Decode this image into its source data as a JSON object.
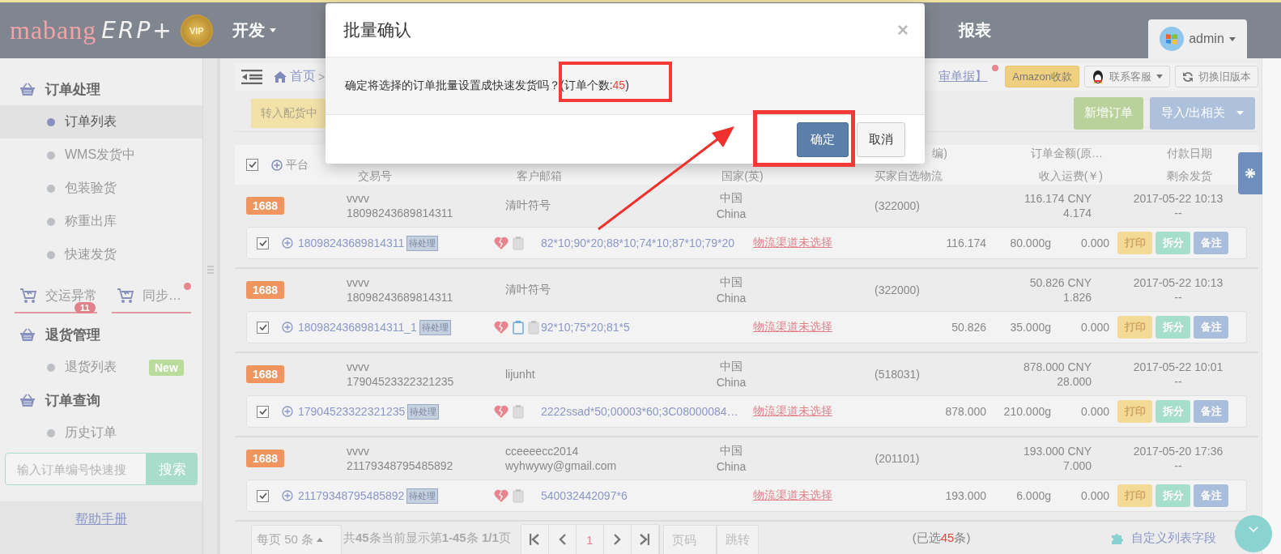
{
  "header": {
    "logo": "mabang",
    "logo_suffix": "ERP+",
    "badge": "VIP",
    "nav": [
      {
        "label": "开发",
        "dropdown": true
      },
      {
        "label": "报表",
        "dropdown": false
      }
    ],
    "user": "admin"
  },
  "sidebar": {
    "blocks": [
      {
        "kind": "section",
        "title": "订单处理",
        "items": [
          {
            "label": "订单列表",
            "selected": true
          },
          {
            "label": "WMS发货中",
            "selected": false
          },
          {
            "label": "包装验货",
            "selected": false
          },
          {
            "label": "称重出库",
            "selected": false
          },
          {
            "label": "快速发货",
            "selected": false
          }
        ]
      },
      {
        "kind": "shortcuts",
        "items": [
          {
            "label": "交运异常",
            "badge": "11",
            "alert": false
          },
          {
            "label": "同步…",
            "alert": true
          }
        ]
      },
      {
        "kind": "section",
        "title": "退货管理",
        "items": [
          {
            "label": "退货列表",
            "selected": false,
            "badge": "New"
          }
        ]
      },
      {
        "kind": "section",
        "title": "订单查询",
        "items": [
          {
            "label": "历史订单",
            "selected": false
          }
        ]
      }
    ],
    "search": {
      "placeholder": "输入订单编号快速搜",
      "button": "搜索"
    },
    "help": "帮助手册"
  },
  "breadcrumb": {
    "home": "首页",
    "separator": ">",
    "link": "审单据】",
    "link_alert": true
  },
  "top_buttons": [
    {
      "label": "Amazon收款",
      "kind": "plain"
    },
    {
      "label": "联系客服",
      "kind": "qq"
    },
    {
      "label": "切换旧版本",
      "kind": "refresh"
    }
  ],
  "toolbar": {
    "left": "转入配货中",
    "new_order": "新增订单",
    "import_export": "导入/出相关"
  },
  "table": {
    "select_all": true,
    "header_top": [
      "平台",
      "编)",
      "订单金额(原…",
      "付款日期"
    ],
    "header_bottom": [
      "交易号",
      "客户邮箱",
      "国家(英)",
      "买家自选物流",
      "收入运费(￥)",
      "剩余发货"
    ],
    "orders": [
      {
        "platform": "1688",
        "shop": "vvvv",
        "trade_no": "18098243689814311",
        "customer": [
          "清叶符号"
        ],
        "country_cn": "中国",
        "country_en": "China",
        "postcode": "(322000)",
        "amount": "116.174 CNY",
        "shipping": "4.174",
        "date": "2017-05-22 10:13",
        "remain": "--",
        "checked": true,
        "order_no": "18098243689814311",
        "status": "待处理",
        "memo": false,
        "sku": "82*10;90*20;88*10;74*10;87*10;79*20",
        "logistics": "物流渠道未选择",
        "price": "116.174",
        "weight": "80.000g",
        "fee": "0.000",
        "actions": [
          "打印",
          "拆分",
          "备注"
        ]
      },
      {
        "platform": "1688",
        "shop": "vvvv",
        "trade_no": "18098243689814311",
        "customer": [
          "清叶符号"
        ],
        "country_cn": "中国",
        "country_en": "China",
        "postcode": "(322000)",
        "amount": "50.826 CNY",
        "shipping": "1.826",
        "date": "2017-05-22 10:13",
        "remain": "--",
        "checked": true,
        "order_no": "18098243689814311_1",
        "status": "待处理",
        "memo": true,
        "sku": "92*10;75*20;81*5",
        "logistics": "物流渠道未选择",
        "price": "50.826",
        "weight": "35.000g",
        "fee": "0.000",
        "actions": [
          "打印",
          "拆分",
          "备注"
        ]
      },
      {
        "platform": "1688",
        "shop": "vvvv",
        "trade_no": "17904523322321235",
        "customer": [
          "lijunht"
        ],
        "country_cn": "中国",
        "country_en": "China",
        "postcode": "(518031)",
        "amount": "878.000 CNY",
        "shipping": "28.000",
        "date": "2017-05-22 10:01",
        "remain": "--",
        "checked": true,
        "order_no": "17904523322321235",
        "status": "待处理",
        "memo": false,
        "sku": "2222ssad*50;00003*60;3C08000084…",
        "logistics": "物流渠道未选择",
        "price": "878.000",
        "weight": "210.000g",
        "fee": "0.000",
        "actions": [
          "打印",
          "拆分",
          "备注"
        ]
      },
      {
        "platform": "1688",
        "shop": "vvvv",
        "trade_no": "21179348795485892",
        "customer": [
          "cceeeecc2014",
          "wyhwywy@gmail.com"
        ],
        "country_cn": "中国",
        "country_en": "China",
        "postcode": "(201101)",
        "amount": "193.000 CNY",
        "shipping": "7.000",
        "date": "2017-05-20 17:36",
        "remain": "--",
        "checked": true,
        "order_no": "21179348795485892",
        "status": "待处理",
        "memo": false,
        "sku": "540032442097*6",
        "logistics": "物流渠道未选择",
        "price": "193.000",
        "weight": "6.000g",
        "fee": "0.000",
        "actions": [
          "打印",
          "拆分",
          "备注"
        ]
      }
    ]
  },
  "pagination": {
    "per_page": "每页 50 条",
    "summary": "共**45**条当前显示第**1-45**条 **1/1**页",
    "current_page": "1",
    "page_placeholder": "页码",
    "go": "跳转",
    "selected_before": "(已选",
    "selected_count": "45",
    "selected_after": "条)",
    "custom_fields": "自定义列表字段"
  },
  "dialog": {
    "title": "批量确认",
    "close": "×",
    "message_before": "确定将选择的订单批量设置成快速发货吗？(订单个数:",
    "count": "45",
    "message_after": ")",
    "confirm": "确定",
    "cancel": "取消"
  }
}
